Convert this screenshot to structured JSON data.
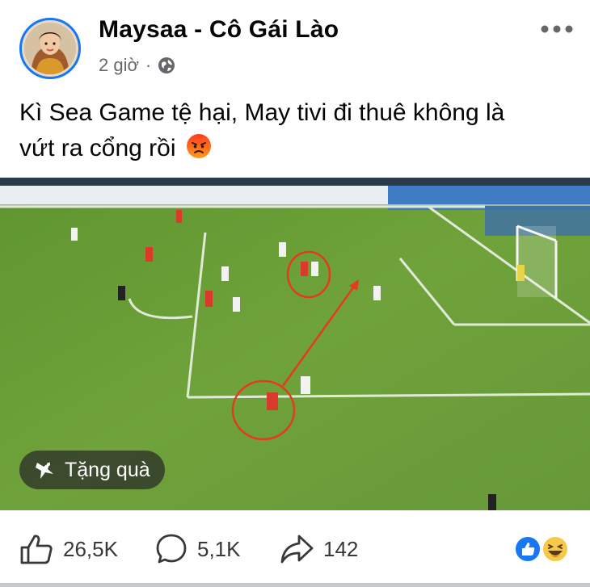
{
  "post": {
    "author": "Maysaa - Cô Gái Lào",
    "time": "2 giờ",
    "privacy_icon": "globe-icon",
    "menu_icon": "more-options-icon",
    "text_line1": "Kì Sea Game tệ hại, May tivi đi thuê không là",
    "text_line2": "vứt ra cổng rồi",
    "text_emoji": "angry-face-icon"
  },
  "media": {
    "type": "football-match-screenshot",
    "gift_label": "Tặng quà",
    "gift_icon": "gift-icon"
  },
  "actions": {
    "likes": "26,5K",
    "comments": "5,1K",
    "shares": "142"
  },
  "reactions": [
    "like-icon",
    "haha-icon"
  ],
  "colors": {
    "accent": "#1877f2",
    "text": "#050505",
    "muted": "#65676b",
    "pitch": "#6b9a35",
    "annotation": "#e53a1e"
  }
}
